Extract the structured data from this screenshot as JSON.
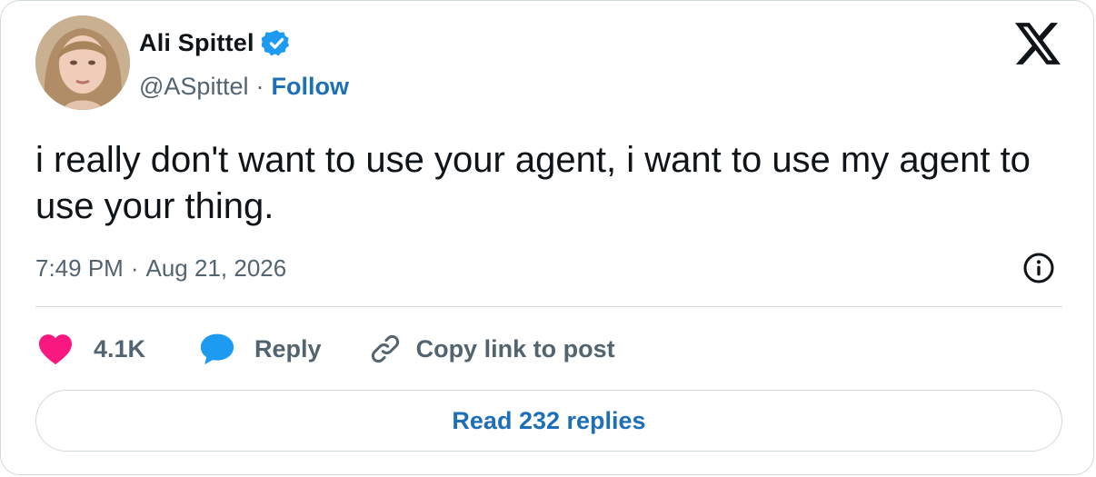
{
  "author": {
    "display_name": "Ali Spittel",
    "handle": "@ASpittel",
    "separator": "·",
    "follow_label": "Follow",
    "verified": true
  },
  "tweet": {
    "text": "i really don't want to use your agent, i want to use my agent to use your thing.",
    "time": "7:49 PM",
    "separator": "·",
    "date": "Aug 21, 2026"
  },
  "actions": {
    "like_count": "4.1K",
    "reply_label": "Reply",
    "copy_link_label": "Copy link to post"
  },
  "read_replies_label": "Read 232 replies",
  "icons": {
    "brand": "x-logo-icon",
    "verified": "verified-badge-icon",
    "info": "info-icon",
    "like": "heart-icon",
    "reply": "speech-bubble-icon",
    "copy": "link-icon"
  },
  "colors": {
    "text_primary": "#0f1419",
    "text_secondary": "#536471",
    "link_blue": "#1d6fb8",
    "verified_blue": "#1d9bf0",
    "heart_pink": "#f91880",
    "border": "#cfd9de"
  }
}
